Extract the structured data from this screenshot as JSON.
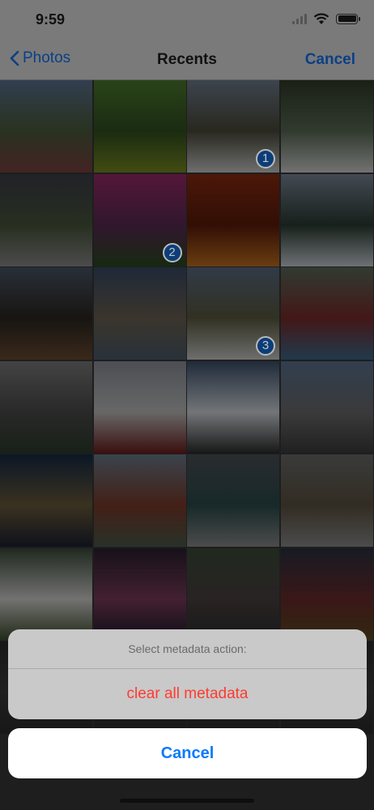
{
  "status": {
    "time": "9:59"
  },
  "nav": {
    "back_label": "Photos",
    "title": "Recents",
    "cancel_label": "Cancel"
  },
  "photos": [
    {
      "name": "photo-grass-coast",
      "c1": "#5a7190",
      "c2": "#4b5a3a",
      "c3": "#7a4040",
      "selected": ""
    },
    {
      "name": "photo-green-leaves",
      "c1": "#4d7a2f",
      "c2": "#2f4f1f",
      "c3": "#7a8a20",
      "selected": ""
    },
    {
      "name": "photo-waterfall-cliff",
      "c1": "#6f7c8c",
      "c2": "#4a4a3a",
      "c3": "#c8c8c8",
      "selected": "1"
    },
    {
      "name": "photo-mossy-waterfall",
      "c1": "#2f3a25",
      "c2": "#5a6a55",
      "c3": "#cfcfcf",
      "selected": ""
    },
    {
      "name": "photo-skogafoss",
      "c1": "#3b3e47",
      "c2": "#47553a",
      "c3": "#8a8a8a",
      "selected": ""
    },
    {
      "name": "photo-pink-flowers",
      "c1": "#9a2a68",
      "c2": "#5a2a55",
      "c3": "#2a4a20",
      "selected": "2"
    },
    {
      "name": "photo-autumn-path",
      "c1": "#8a2a10",
      "c2": "#5a1a08",
      "c3": "#c07020",
      "selected": ""
    },
    {
      "name": "photo-snowy-forest",
      "c1": "#7a8596",
      "c2": "#2a3a32",
      "c3": "#c8cdd4",
      "selected": ""
    },
    {
      "name": "photo-sailing-ship",
      "c1": "#4a5566",
      "c2": "#2a2620",
      "c3": "#6a4a30",
      "selected": ""
    },
    {
      "name": "photo-harbor-buildings",
      "c1": "#3a4a66",
      "c2": "#6a6050",
      "c3": "#4a5a6a",
      "selected": ""
    },
    {
      "name": "photo-hollywood-sign",
      "c1": "#5a6a80",
      "c2": "#5a5a40",
      "c3": "#c8c8c8",
      "selected": "3"
    },
    {
      "name": "photo-marbles",
      "c1": "#5a6a5a",
      "c2": "#7a2a2a",
      "c3": "#3a6a8a",
      "selected": ""
    },
    {
      "name": "photo-two-men-bench",
      "c1": "#7a7a7a",
      "c2": "#4a4a4a",
      "c3": "#2a3a2a",
      "selected": ""
    },
    {
      "name": "photo-snow-train",
      "c1": "#8a8f98",
      "c2": "#bcbcbc",
      "c3": "#6a1a1a",
      "selected": ""
    },
    {
      "name": "photo-snowy-peak",
      "c1": "#3a4e6a",
      "c2": "#d0d4da",
      "c3": "#2a2a2a",
      "selected": ""
    },
    {
      "name": "photo-st-peters",
      "c1": "#5a7090",
      "c2": "#6a6a6a",
      "c3": "#3a3a3a",
      "selected": ""
    },
    {
      "name": "photo-tower-bridge",
      "c1": "#152a45",
      "c2": "#6a5a3a",
      "c3": "#1a2030",
      "selected": ""
    },
    {
      "name": "photo-tokyo-station",
      "c1": "#6a7a8a",
      "c2": "#7a3a2a",
      "c3": "#4a5a4a",
      "selected": ""
    },
    {
      "name": "photo-ocean-waves",
      "c1": "#4a5055",
      "c2": "#2a4a4a",
      "c3": "#8a8a8a",
      "selected": ""
    },
    {
      "name": "photo-city-beach",
      "c1": "#6a6a6a",
      "c2": "#5a5040",
      "c3": "#8a8a8a",
      "selected": ""
    },
    {
      "name": "photo-white-dog",
      "c1": "#3a4a3a",
      "c2": "#d0cfcc",
      "c3": "#3a4a2a",
      "selected": ""
    },
    {
      "name": "photo-times-square",
      "c1": "#2a2030",
      "c2": "#7a3a5a",
      "c3": "#1a1a2a",
      "selected": ""
    },
    {
      "name": "photo-narrow-street",
      "c1": "#3a4a3a",
      "c2": "#4a4040",
      "c3": "#2a2a2a",
      "selected": ""
    },
    {
      "name": "photo-city-night",
      "c1": "#2a3040",
      "c2": "#6a2a2a",
      "c3": "#5a4a20",
      "selected": ""
    },
    {
      "name": "photo-extra-1",
      "c1": "#2a2a2a",
      "c2": "#3a3a3a",
      "c3": "#2a2a2a",
      "selected": ""
    },
    {
      "name": "photo-extra-2",
      "c1": "#2a2a2a",
      "c2": "#3a3a3a",
      "c3": "#2a2a2a",
      "selected": ""
    },
    {
      "name": "photo-extra-3",
      "c1": "#2a2a2a",
      "c2": "#3a3a3a",
      "c3": "#2a2a2a",
      "selected": ""
    },
    {
      "name": "photo-extra-4",
      "c1": "#2a2a2a",
      "c2": "#3a3a3a",
      "c3": "#2a2a2a",
      "selected": ""
    }
  ],
  "action_sheet": {
    "title": "Select metadata action:",
    "action_label": "clear all metadata",
    "cancel_label": "Cancel"
  },
  "colors": {
    "accent": "#0a7aff",
    "destructive": "#ff3b30",
    "badge": "#0d3d78"
  }
}
